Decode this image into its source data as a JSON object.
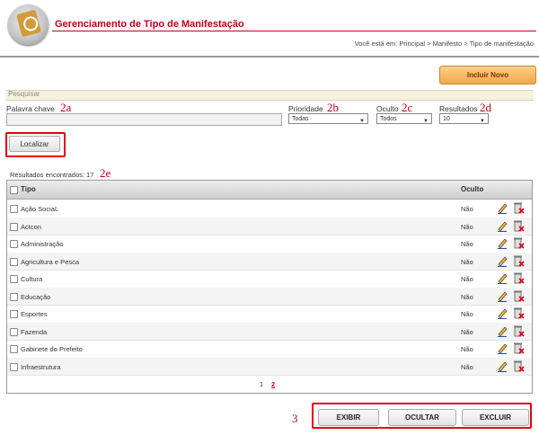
{
  "header": {
    "title": "Gerenciamento de Tipo de Manifestação",
    "breadcrumb": "Você está em: Principal > Manifesto > Tipo de manifestação"
  },
  "actions": {
    "incluir_label": "Incluir Novo"
  },
  "search": {
    "section_label": "Pesquisar",
    "keyword_label": "Palavra chave",
    "keyword_value": "",
    "prioridade_label": "Prioridade",
    "prioridade_value": "Todas",
    "oculto_label": "Oculto",
    "oculto_value": "Todos",
    "resultados_label": "Resultados",
    "resultados_value": "10",
    "localizar_label": "Localizar",
    "results_found": "Resultados encontrados: 17"
  },
  "annotations": {
    "a2a": "2a",
    "a2b": "2b",
    "a2c": "2c",
    "a2d": "2d",
    "a2e": "2e",
    "a3": "3"
  },
  "table": {
    "col_tipo": "Tipo",
    "col_oculto": "Oculto",
    "rows": [
      {
        "tipo": "Ação SociaL",
        "oculto": "Não"
      },
      {
        "tipo": "Actcon",
        "oculto": "Não"
      },
      {
        "tipo": "Administração",
        "oculto": "Não"
      },
      {
        "tipo": "Agricultura e Pesca",
        "oculto": "Não"
      },
      {
        "tipo": "Cultura",
        "oculto": "Não"
      },
      {
        "tipo": "Educação",
        "oculto": "Não"
      },
      {
        "tipo": "Esportes",
        "oculto": "Não"
      },
      {
        "tipo": "Fazenda",
        "oculto": "Não"
      },
      {
        "tipo": "Gabinete do Prefeito",
        "oculto": "Não"
      },
      {
        "tipo": "Infraestrutura",
        "oculto": "Não"
      }
    ],
    "pages": [
      "1",
      "2"
    ]
  },
  "bottom": {
    "exibir": "EXIBIR",
    "ocultar": "OCULTAR",
    "excluir": "EXCLUIR"
  },
  "colors": {
    "brand_red": "#c0001a",
    "highlight": "#e3000f",
    "incluir_bg": "#f0a94b"
  }
}
